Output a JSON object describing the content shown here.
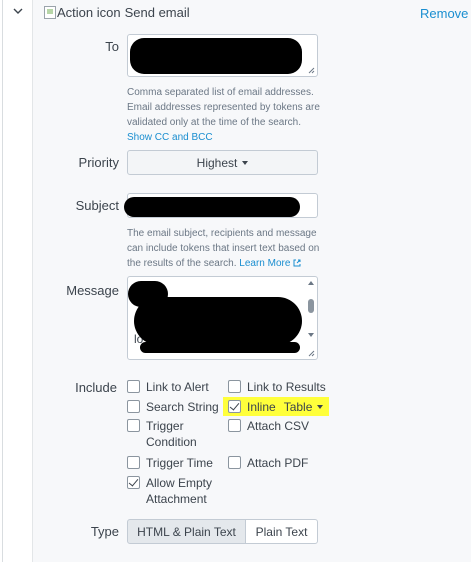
{
  "header": {
    "broken_image_alt": "Action icon",
    "title": "Send email",
    "remove_label": "Remove"
  },
  "to": {
    "label": "To",
    "help_line1": "Comma separated list of email addresses.",
    "help_line2": "Email addresses represented by tokens are",
    "help_line3": "validated only at the time of the search.",
    "help_link": "Show CC and BCC"
  },
  "priority": {
    "label": "Priority",
    "selected": "Highest"
  },
  "subject": {
    "label": "Subject",
    "help_line1": "The email subject, recipients and message",
    "help_line2": "can include tokens that insert text based on",
    "help_line3": "the results of the search.",
    "help_link": "Learn More"
  },
  "message": {
    "label": "Message",
    "fragment": "lo"
  },
  "include": {
    "label": "Include",
    "options": [
      {
        "label": "Link to Alert",
        "checked": false
      },
      {
        "label": "Link to Results",
        "checked": false
      },
      {
        "label": "Search String",
        "checked": false
      },
      {
        "label": "Inline",
        "checked": true,
        "format": "Table"
      },
      {
        "label_line1": "Trigger",
        "label_line2": "Condition",
        "checked": false
      },
      {
        "label": "Attach CSV",
        "checked": false
      },
      {
        "label": "Trigger Time",
        "checked": false
      },
      {
        "label": "Attach PDF",
        "checked": false
      },
      {
        "label_line1": "Allow Empty",
        "label_line2": "Attachment",
        "checked": true
      }
    ]
  },
  "type": {
    "label": "Type",
    "options": [
      "HTML & Plain Text",
      "Plain Text"
    ],
    "selected": "HTML & Plain Text"
  },
  "colors": {
    "link": "#1a8ed0",
    "highlight": "#ffff3b",
    "redaction": "#000000"
  }
}
